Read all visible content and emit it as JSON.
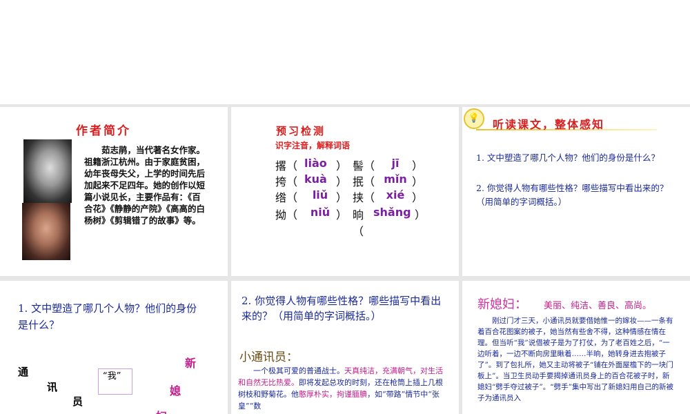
{
  "slide1": {
    "title": "作者简介",
    "bio": "　　茹志鹃，当代著名女作家。祖籍浙江杭州。由于家庭贫困，幼年丧母失父，上学的时间先后加起来不足四年。她的创作以短篇小说见长，主要作品有：《百合花》《静静的产院》《高高的白杨树》《剪辑错了的故事》等。"
  },
  "slide2": {
    "title": "预习检测",
    "subtitle": "识字注音，解释词语",
    "rows": [
      {
        "c1": "撂（",
        "p1": "liào",
        "e1": "）",
        "c2": "髻（",
        "p2": "jī",
        "e2": "）"
      },
      {
        "c1": "挎（",
        "p1": "kuà",
        "e1": "）",
        "c2": "抿（",
        "p2": "mǐn",
        "e2": "）"
      },
      {
        "c1": "绺（",
        "p1": "liǔ",
        "e1": "）",
        "c2": "挟（",
        "p2": "xié",
        "e2": "）"
      },
      {
        "c1": "拗（",
        "p1": "niǔ",
        "e1": "）",
        "c2": "晌（",
        "p2": "shǎng",
        "e2": "）"
      }
    ]
  },
  "slide3": {
    "title": "听读课文，整体感知",
    "q1": "1. 文中塑造了哪几个人物？他们的身份是什么？",
    "q2": "2. 你觉得人物有哪些性格？哪些描写中看出来的？（用简单的字词概括。）"
  },
  "slide4": {
    "question": "1. 文中塑造了哪几个人物？他们的身份是什么？",
    "chars_left": [
      "通",
      "讯",
      "员"
    ],
    "box": "“我”",
    "chars_right": [
      "新",
      "媳",
      "妇"
    ]
  },
  "slide5": {
    "question": "2. 你觉得人物有哪些性格？哪些描写中看出来的？（用简单的字词概括。）",
    "heading": "小通讯员：",
    "p_a": "　　一个极其可爱的普通战士。",
    "p_b": "天真纯洁，充满朝气，对生活和自然无比热爱。",
    "p_c": "即将发起总攻的时刻，还在枪筒上插上几根树枝和野菊花。他",
    "p_d": "憨厚朴实，拘谨腼腆",
    "p_e": "，如“带路”情节中“张皇”“数"
  },
  "slide6": {
    "heading": "新媳妇：",
    "traits": "美丽、纯洁、善良、高尚。",
    "body": "　　刚过门才三天，小通讯员就要借她惟一的嫁妆——一条有着百合花图案的被子，她当然有些舍不得，这种情感在情在理。但当听“我”说借被子是为了打仗，为了老百姓之后，“一边听着，一边不断向房里瞅着……半晌，她转身进去抱被子了”。到了包扎所，她又主动将被子“铺在外面屋檐下的一块门板上”。当卫生员动手要揭掉通讯员身上的百合花被子时，新媳妇“劈手夺过被子”。“劈手”集中写出了新媳妇用自己的新被子为通讯员入"
  }
}
